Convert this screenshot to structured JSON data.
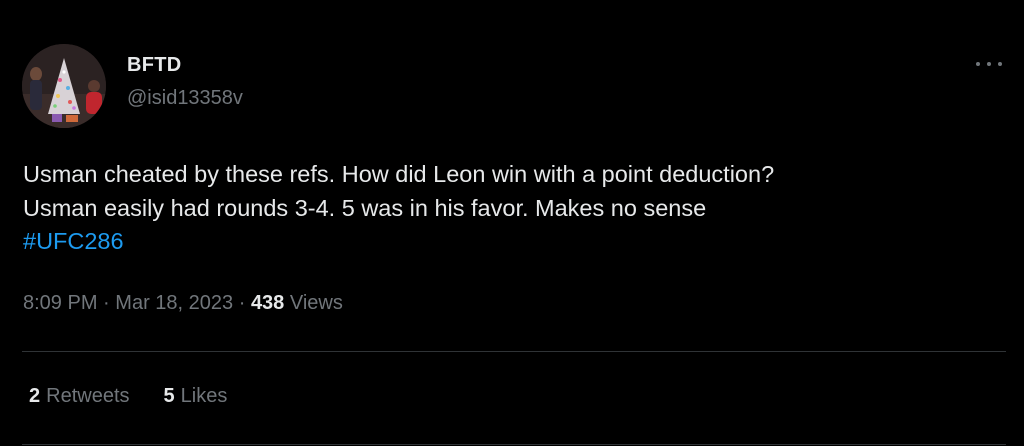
{
  "author": {
    "display_name": "BFTD",
    "handle": "@isid13358v"
  },
  "tweet": {
    "lines": [
      "Usman cheated by these refs. How did Leon win with a point deduction?",
      "Usman easily had rounds 3-4. 5 was in his favor. Makes no sense"
    ],
    "hashtag": "#UFC286"
  },
  "meta": {
    "time": "8:09 PM",
    "separator": "·",
    "date": "Mar 18, 2023",
    "views_count": "438",
    "views_label": "Views"
  },
  "stats": {
    "retweets_count": "2",
    "retweets_label": "Retweets",
    "likes_count": "5",
    "likes_label": "Likes"
  },
  "colors": {
    "background": "#000000",
    "text": "#e7e9ea",
    "secondary": "#71767b",
    "link": "#1d9bf0",
    "divider": "#2f3336"
  },
  "icons": {
    "more": "more-horizontal-icon"
  }
}
